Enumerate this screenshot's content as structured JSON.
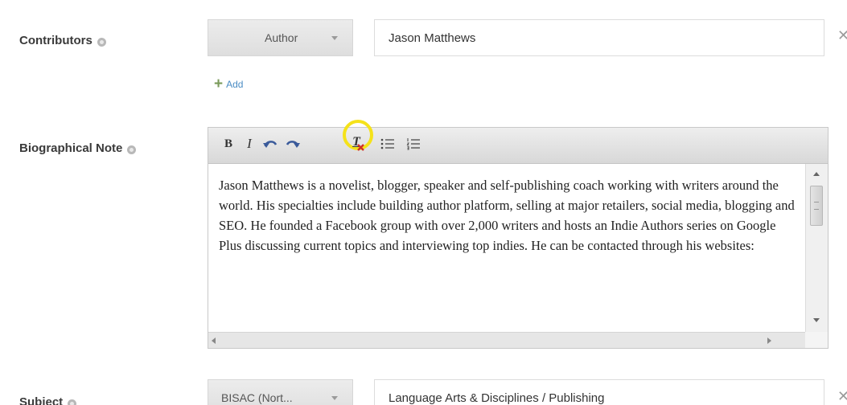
{
  "contributors": {
    "label": "Contributors",
    "role_select": "Author",
    "name_value": "Jason Matthews",
    "remove_glyph": "✕",
    "add_label": "Add",
    "add_glyph": "+"
  },
  "bio": {
    "label": "Biographical Note",
    "toolbar": {
      "bold": "B",
      "italic": "I",
      "clear_format": "T"
    },
    "text": "Jason Matthews is a novelist, blogger, speaker and self-publishing coach working with writers around the world. His specialties include building author platform, selling at major retailers, social media, blogging and SEO. He founded a Facebook group with over 2,000 writers and hosts an Indie Authors series on Google Plus discussing current topics and interviewing top indies. He can be contacted through his websites:"
  },
  "subject": {
    "label": "Subject",
    "scheme_select": "BISAC (Nort...",
    "value": "Language Arts & Disciplines / Publishing",
    "remove_glyph": "✕"
  },
  "icons": {
    "help": "help-icon",
    "undo": "undo-icon",
    "redo": "redo-icon",
    "clear": "clear-formatting-icon",
    "bullets": "bulleted-list-icon",
    "numbers": "numbered-list-icon"
  },
  "colors": {
    "highlight_ring": "#f5e21a",
    "link": "#4a8cc4",
    "clear_x": "#d0302a"
  }
}
